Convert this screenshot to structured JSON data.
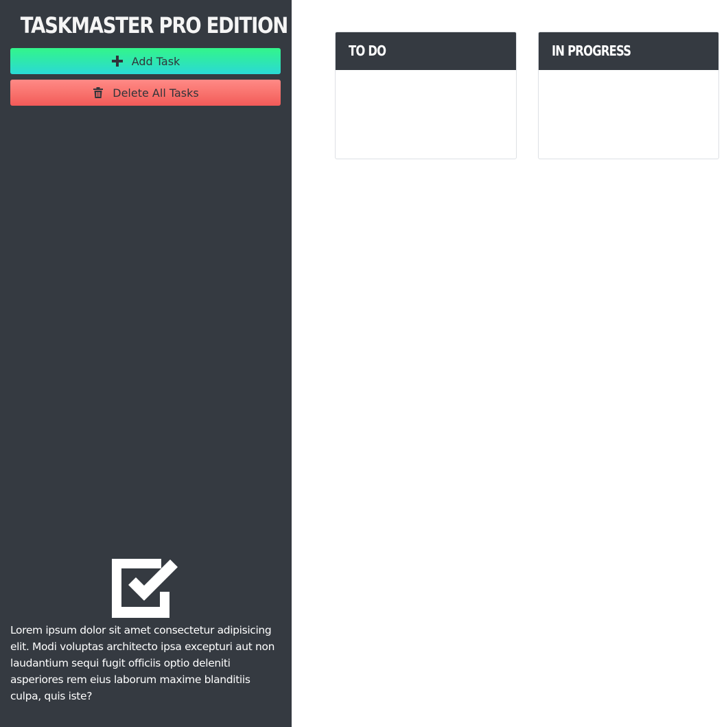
{
  "sidebar": {
    "title": "TASKMASTER PRO EDITION",
    "add_button": {
      "label": "Add Task",
      "icon": "plus-icon",
      "color_top": "#33f58a",
      "color_bottom": "#2ad9d6"
    },
    "delete_button": {
      "label": "Delete All Tasks",
      "icon": "trash-icon",
      "color_top": "#ff8a86",
      "color_bottom": "#f25a58"
    },
    "logo_icon": "checkbox-check-icon",
    "description": "Lorem ipsum dolor sit amet consectetur adipisicing elit. Modi voluptas architecto ipsa excepturi aut non laudantium sequi fugit officiis optio deleniti asperiores rem eius laborum maxime blanditiis culpa, quis iste?",
    "background": "#353a41"
  },
  "board": {
    "columns": [
      {
        "title": "TO DO",
        "tasks": []
      },
      {
        "title": "IN PROGRESS",
        "tasks": []
      }
    ]
  }
}
